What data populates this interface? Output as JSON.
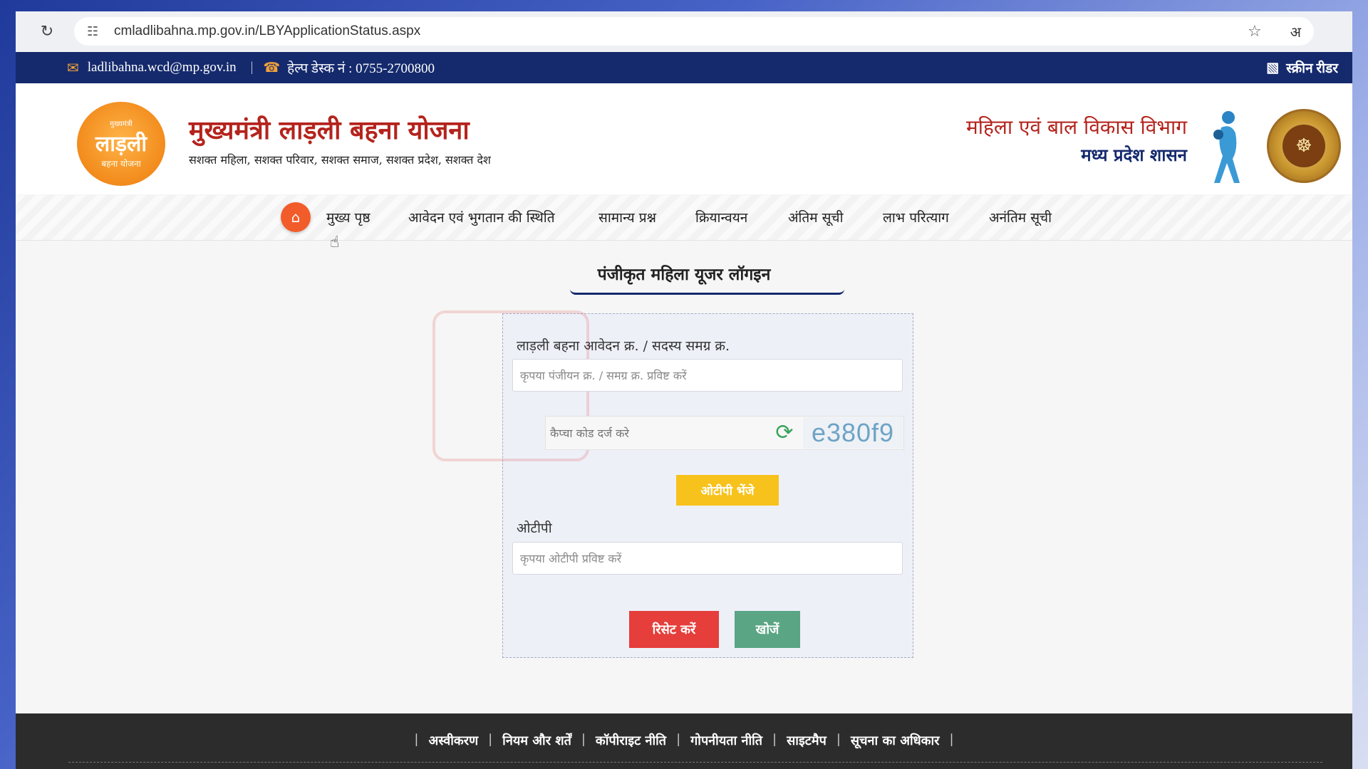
{
  "browser": {
    "url": "cmladlibahna.mp.gov.in/LBYApplicationStatus.aspx",
    "translate_label": "अ"
  },
  "topbar": {
    "email": "ladlibahna.wcd@mp.gov.in",
    "helpdesk": "हेल्प डेस्क नं : 0755-2700800",
    "screen_reader": "स्क्रीन रीडर"
  },
  "header": {
    "logo_line1": "मुख्यमंत्री",
    "logo_line2": "लाड़ली",
    "logo_line3": "बहना योजना",
    "title": "मुख्यमंत्री लाड़ली बहना योजना",
    "subtitle": "सशक्त महिला, सशक्त परिवार, सशक्त समाज, सशक्त प्रदेश, सशक्त देश",
    "dept_title": "महिला एवं बाल विकास विभाग",
    "dept_sub": "मध्य प्रदेश शासन"
  },
  "nav": {
    "items": [
      "मुख्य पृष्ठ",
      "आवेदन एवं भुगतान की स्थिति",
      "सामान्य प्रश्न",
      "क्रियान्वयन",
      "अंतिम सूची",
      "लाभ परित्याग",
      "अनंतिम सूची"
    ]
  },
  "login": {
    "title": "पंजीकृत महिला यूजर लॉगइन",
    "app_label": "लाड़ली बहना आवेदन क्र. / सदस्य समग्र क्र.",
    "app_placeholder": "कृपया पंजीयन क्र. / समग्र क्र. प्रविष्ट करें",
    "captcha_placeholder": "कैप्चा कोड दर्ज करे",
    "captcha_code": "e380f9",
    "otp_button": "ओटीपी भेंजे",
    "otp_label": "ओटीपी",
    "otp_placeholder": "कृपया ओटीपी प्रविष्ट करें",
    "reset_button": "रिसेट करें",
    "search_button": "खोजें"
  },
  "footer": {
    "links": [
      "अस्वीकरण",
      "नियम और शर्तें",
      "कॉपीराइट नीति",
      "गोपनीयता नीति",
      "साइटमैप",
      "सूचना का अधिकार"
    ]
  },
  "colors": {
    "nav_bar": "#152a6d",
    "title_red": "#b4231c",
    "otp_yellow": "#f7c21b",
    "reset_red": "#e53e3b",
    "search_green": "#5aa584"
  }
}
